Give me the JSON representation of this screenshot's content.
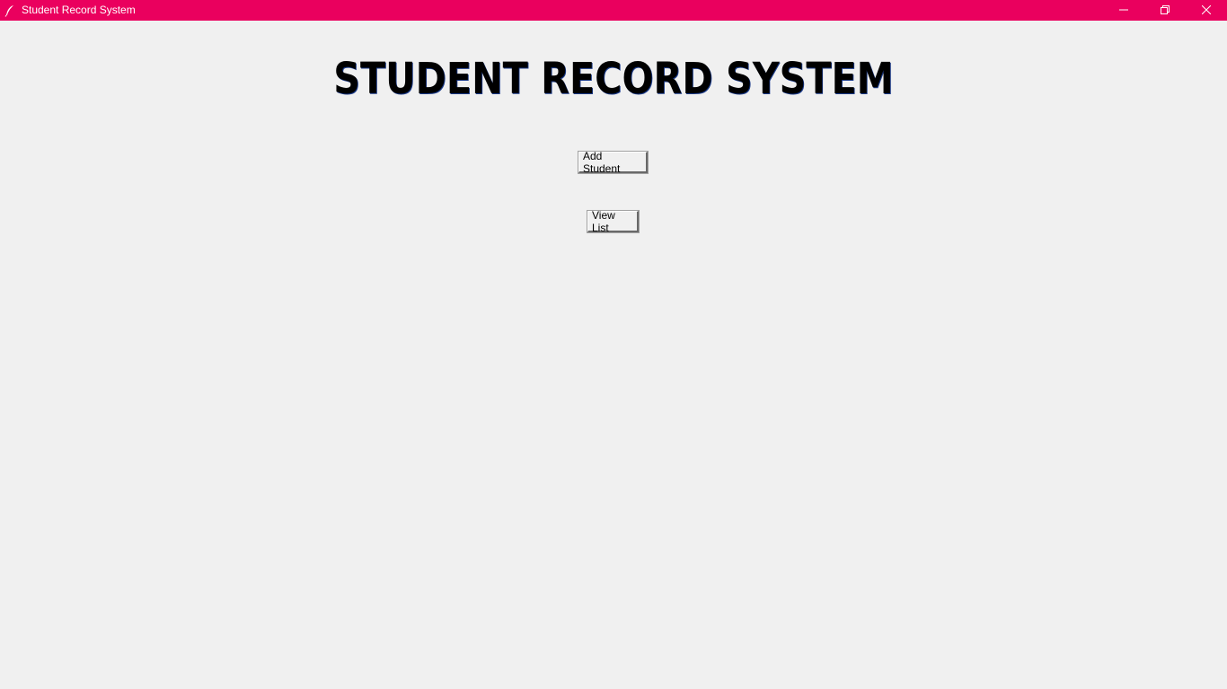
{
  "window": {
    "title": "Student Record System",
    "titlebar_color": "#ea005e",
    "icon": "feather-icon",
    "controls": [
      "minimize-icon",
      "restore-icon",
      "close-icon"
    ]
  },
  "main": {
    "heading": "STUDENT RECORD SYSTEM",
    "add_student_label": "Add Student",
    "view_list_label": "View List"
  },
  "colors": {
    "background": "#f0f0f0",
    "heading_text": "#000000"
  }
}
